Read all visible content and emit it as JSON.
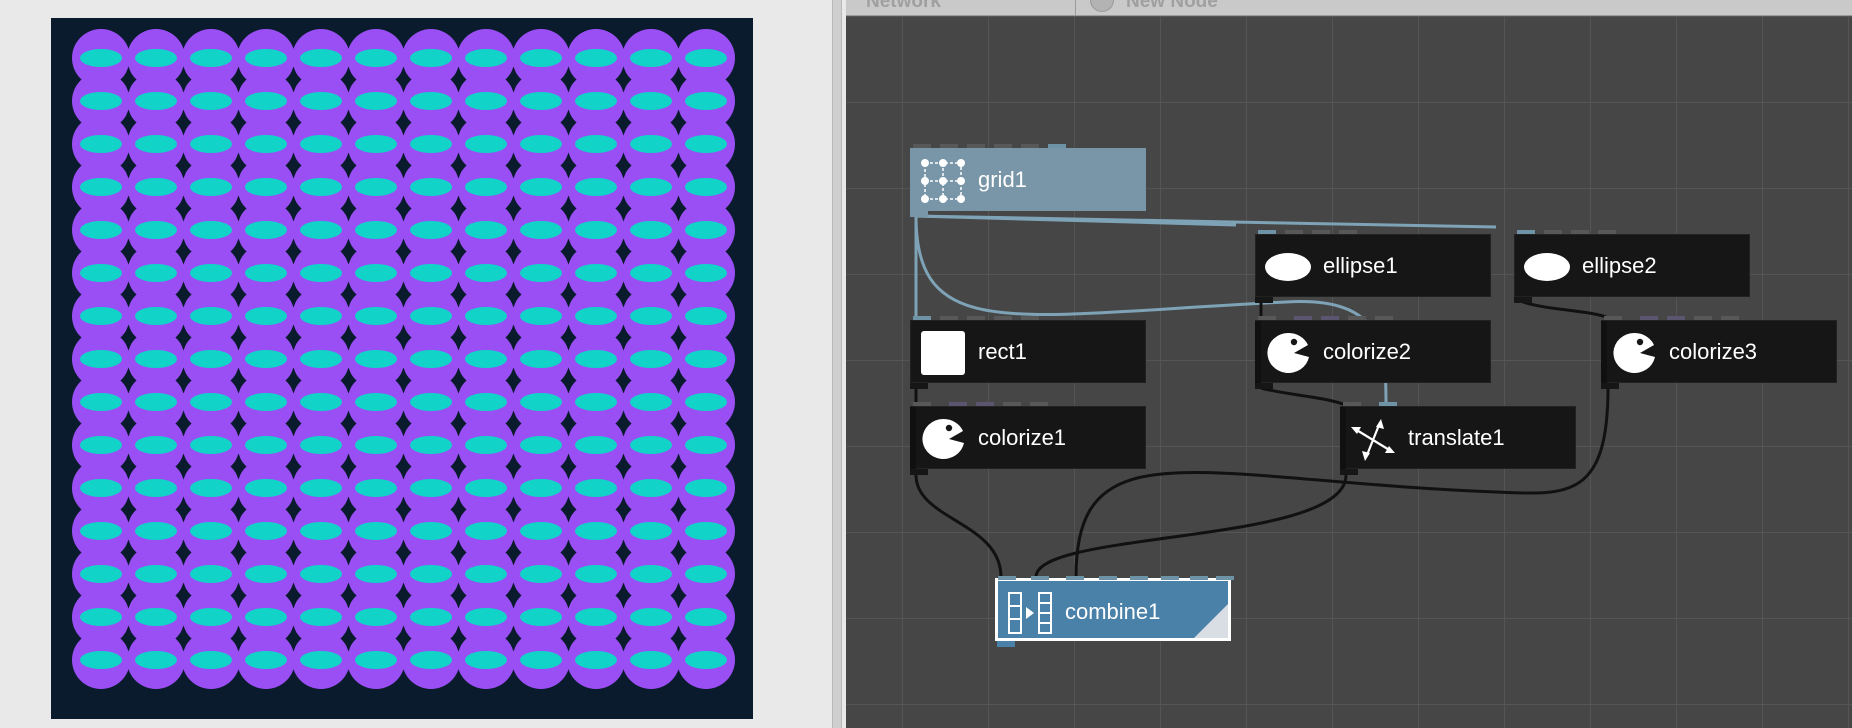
{
  "viewer": {
    "canvas_background": "#0b1b2e",
    "grid_columns": 12,
    "grid_rows": 15,
    "circle_color": "#9a4ff5",
    "ellipse_color": "#11d3c8",
    "diamond_color": "#0b1b2e"
  },
  "network": {
    "header": {
      "network_tab_label": "Network",
      "new_node_label": "New Node"
    },
    "nodes": {
      "grid1": {
        "label": "grid1",
        "icon": "grid-icon"
      },
      "ellipse1": {
        "label": "ellipse1",
        "icon": "ellipse-icon"
      },
      "ellipse2": {
        "label": "ellipse2",
        "icon": "ellipse-icon"
      },
      "rect1": {
        "label": "rect1",
        "icon": "rect-icon"
      },
      "colorize1": {
        "label": "colorize1",
        "icon": "colorize-icon"
      },
      "colorize2": {
        "label": "colorize2",
        "icon": "colorize-icon"
      },
      "colorize3": {
        "label": "colorize3",
        "icon": "colorize-icon"
      },
      "translate1": {
        "label": "translate1",
        "icon": "translate-icon"
      },
      "combine1": {
        "label": "combine1",
        "icon": "combine-icon"
      }
    },
    "colors": {
      "grid_background": "#464646",
      "grid_line": "#555555",
      "node_background": "#161616",
      "selected_node": "#7896a8",
      "rendered_node": "#4a81a8",
      "connection_light": "#7fa3b6",
      "connection_dark": "#111111"
    }
  }
}
